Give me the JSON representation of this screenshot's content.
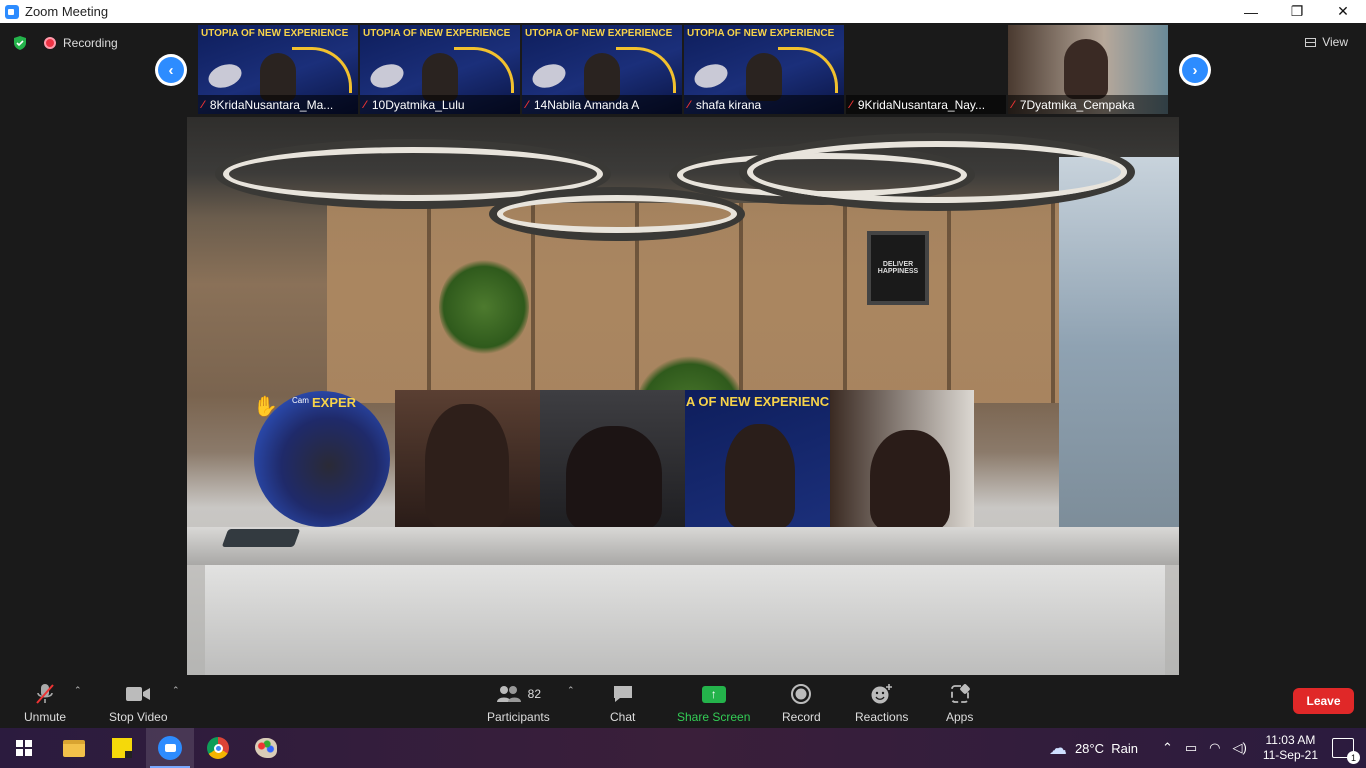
{
  "window": {
    "title": "Zoom Meeting",
    "minimize": "—",
    "maximize": "❐",
    "close": "✕"
  },
  "status": {
    "recording": "Recording",
    "view": "View"
  },
  "thumbnails": [
    {
      "name": "8KridaNusantara_Ma...",
      "poster": true,
      "poster_title": "UTOPIA OF NEW EXPERIENCE"
    },
    {
      "name": "10Dyatmika_Lulu",
      "poster": true,
      "poster_title": "UTOPIA OF NEW EXPERIENCE"
    },
    {
      "name": "14Nabila Amanda A",
      "poster": true,
      "poster_title": "UTOPIA OF NEW EXPERIENCE"
    },
    {
      "name": "shafa kirana",
      "poster": true,
      "poster_title": "UTOPIA OF NEW EXPERIENCE"
    },
    {
      "name": "9KridaNusantara_Nay...",
      "poster": false
    },
    {
      "name": "7Dyatmika_Cempaka",
      "poster": false
    }
  ],
  "main_video": {
    "frame_text": "DELIVER HAPPINESS",
    "gallery_poster_text": "A OF NEW EXPERIENC",
    "avatar_label": "Cam",
    "avatar_poster_text": "EXPER"
  },
  "toolbar": {
    "unmute": "Unmute",
    "stop_video": "Stop Video",
    "participants": "Participants",
    "participants_count": "82",
    "chat": "Chat",
    "share_screen": "Share Screen",
    "record": "Record",
    "reactions": "Reactions",
    "apps": "Apps",
    "leave": "Leave"
  },
  "taskbar": {
    "weather": "28°C  Rain",
    "time": "11:03 AM",
    "date": "11-Sep-21",
    "notifications": "1"
  },
  "colors": {
    "zoom_blue": "#2d8cff",
    "leave_red": "#e02828",
    "share_green": "#24b34b",
    "poster_yellow": "#f7d34a"
  }
}
